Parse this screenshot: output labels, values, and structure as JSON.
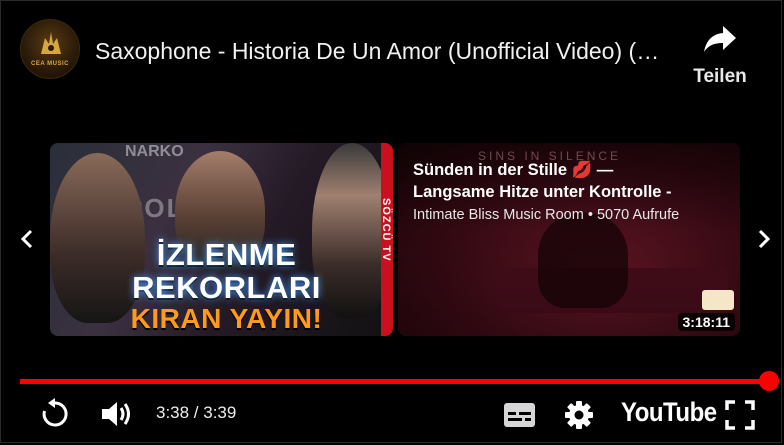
{
  "header": {
    "channel_avatar_text": "CEA MUSIC",
    "title": "Saxophone - Historia De Un Amor (Unofficial Video) (Official Audio)",
    "share_label": "Teilen"
  },
  "end_screen": {
    "left_card": {
      "thumbnail_texts": {
        "brand": "NARKO",
        "backdrop": "POLIS",
        "side_strip": "SÖZCÜ TV",
        "line1": "İZLENME",
        "line2": "REKORLARI",
        "line3": "KIRAN YAYIN!"
      }
    },
    "right_card": {
      "overlay_text": "SINS IN SILENCE",
      "title_line1": "Sünden in der Stille 💋 —",
      "title_line2": "Langsame Hitze unter Kontrolle -",
      "meta": "Intimate Bliss Music Room • 5070 Aufrufe",
      "duration": "3:18:11"
    },
    "icons": {
      "prev": "chevron-left-icon",
      "next": "chevron-right-icon"
    }
  },
  "player": {
    "progress": 1.0,
    "time": "3:38 / 3:39",
    "logo_text": "YouTube",
    "accent_color": "#ff0000",
    "icons": {
      "replay": "replay-icon",
      "volume": "volume-icon",
      "subtitles": "subtitles-icon",
      "settings": "gear-icon",
      "fullscreen": "fullscreen-icon",
      "share": "share-icon"
    }
  }
}
